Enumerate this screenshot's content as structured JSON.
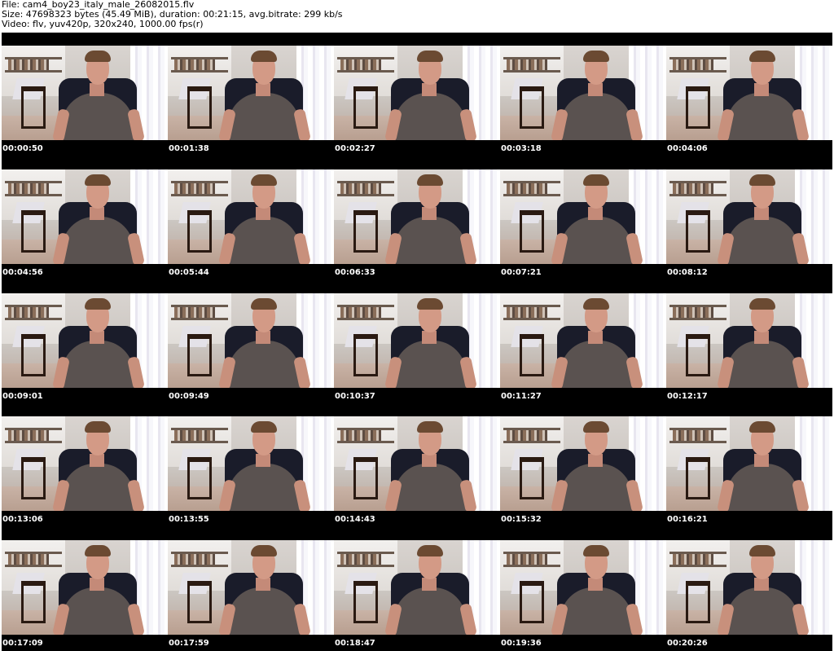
{
  "info": {
    "file_line": "File: cam4_boy23_italy_male_26082015.flv",
    "size_line": "Size: 47698323 bytes (45.49 MiB), duration: 00:21:15, avg.bitrate: 299 kb/s",
    "video_line": "Video: flv, yuv420p, 320x240, 1000.00 fps(r)"
  },
  "thumbnails": [
    {
      "timestamp": "00:00:50"
    },
    {
      "timestamp": "00:01:38"
    },
    {
      "timestamp": "00:02:27"
    },
    {
      "timestamp": "00:03:18"
    },
    {
      "timestamp": "00:04:06"
    },
    {
      "timestamp": "00:04:56"
    },
    {
      "timestamp": "00:05:44"
    },
    {
      "timestamp": "00:06:33"
    },
    {
      "timestamp": "00:07:21"
    },
    {
      "timestamp": "00:08:12"
    },
    {
      "timestamp": "00:09:01"
    },
    {
      "timestamp": "00:09:49"
    },
    {
      "timestamp": "00:10:37"
    },
    {
      "timestamp": "00:11:27"
    },
    {
      "timestamp": "00:12:17"
    },
    {
      "timestamp": "00:13:06"
    },
    {
      "timestamp": "00:13:55"
    },
    {
      "timestamp": "00:14:43"
    },
    {
      "timestamp": "00:15:32"
    },
    {
      "timestamp": "00:16:21"
    },
    {
      "timestamp": "00:17:09"
    },
    {
      "timestamp": "00:17:59"
    },
    {
      "timestamp": "00:18:47"
    },
    {
      "timestamp": "00:19:36"
    },
    {
      "timestamp": "00:20:26"
    }
  ]
}
